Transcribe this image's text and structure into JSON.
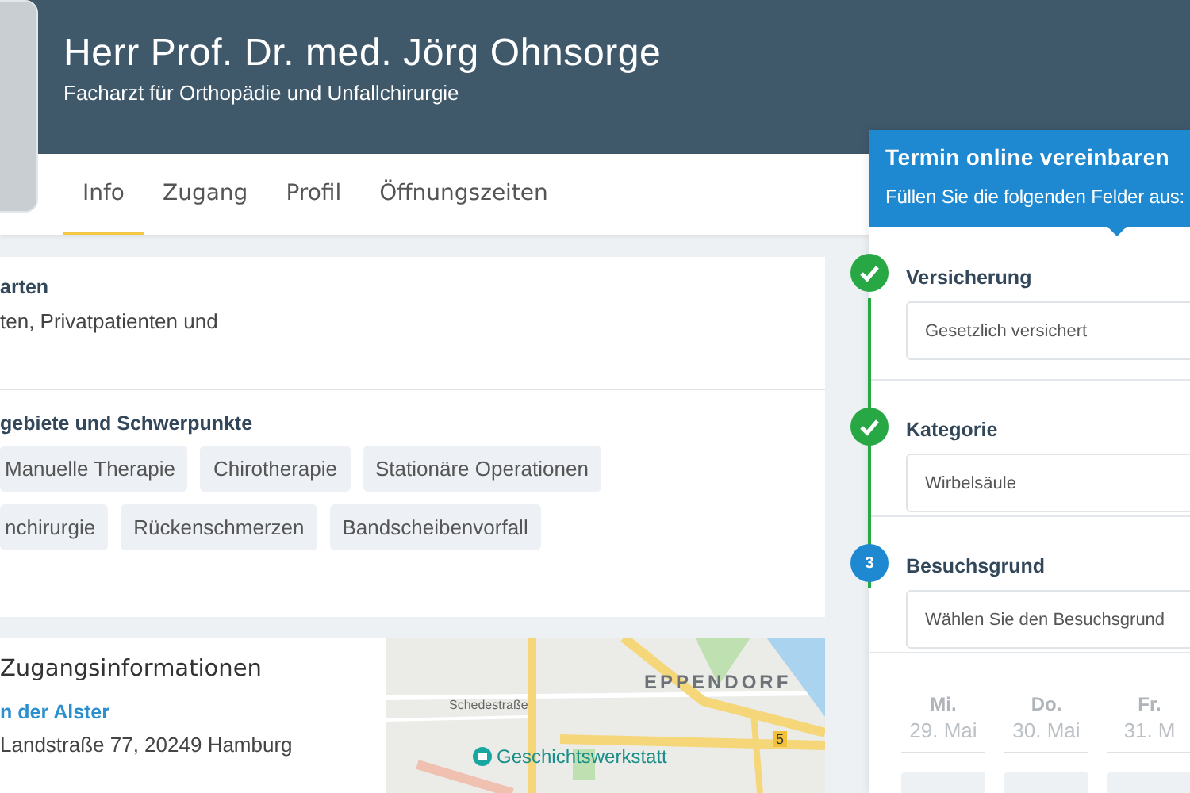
{
  "header": {
    "name": "Herr Prof. Dr. med. Jörg Ohnsorge",
    "subtitle": "Facharzt für Orthopädie und Unfallchirurgie"
  },
  "tabs": [
    {
      "label": "Info",
      "selected": true
    },
    {
      "label": "Zugang",
      "selected": false
    },
    {
      "label": "Profil",
      "selected": false
    },
    {
      "label": "Öffnungszeiten",
      "selected": false
    }
  ],
  "info_card": {
    "sections": [
      {
        "title": "arten",
        "text": "ten, Privatpatienten und"
      },
      {
        "title": "gebiete und Schwerpunkte",
        "chip_rows": [
          [
            "Manuelle Therapie",
            "Chirotherapie",
            "Stationäre Operationen"
          ],
          [
            "nchirurgie",
            "Rückenschmerzen",
            "Bandscheibenvorfall"
          ]
        ]
      }
    ]
  },
  "access_card": {
    "title": "Zugangsinformationen",
    "link": "n der Alster",
    "address": "Landstraße 77, 20249 Hamburg"
  },
  "map": {
    "labels": [
      {
        "kind": "street",
        "text": "Schedestraße"
      },
      {
        "kind": "district",
        "text": "EPPENDORF"
      },
      {
        "kind": "poi",
        "text": "Geschichtswerkstatt"
      },
      {
        "kind": "road_number",
        "text": "5"
      }
    ]
  },
  "booking": {
    "title": "Termin online vereinbaren",
    "subtitle": "Füllen Sie die folgenden Felder aus:",
    "steps": [
      {
        "kind": "done",
        "label": "Versicherung",
        "value": "Gesetzlich versichert"
      },
      {
        "kind": "done",
        "label": "Kategorie",
        "value": "Wirbelsäule"
      },
      {
        "kind": "current",
        "number": "3",
        "label": "Besuchsgrund",
        "placeholder": "Wählen Sie den Besuchsgrund"
      }
    ],
    "calendar": {
      "days": [
        {
          "day": "Mi.",
          "date": "29. Mai"
        },
        {
          "day": "Do.",
          "date": "30. Mai"
        },
        {
          "day": "Fr.",
          "date": "31. M"
        }
      ]
    }
  }
}
